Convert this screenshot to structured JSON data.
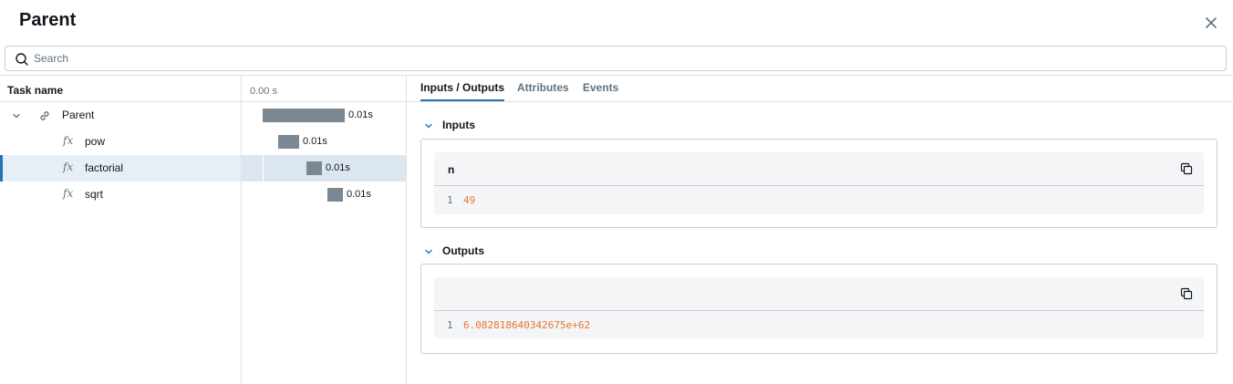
{
  "header": {
    "title": "Parent",
    "close_icon": "close-icon"
  },
  "search": {
    "placeholder": "Search",
    "value": ""
  },
  "tree": {
    "column_header": "Task name",
    "rows": [
      {
        "label": "Parent",
        "icon": "link-icon",
        "expanded": true
      },
      {
        "label": "pow",
        "icon": "function-icon"
      },
      {
        "label": "factorial",
        "icon": "function-icon",
        "selected": true
      },
      {
        "label": "sqrt",
        "icon": "function-icon"
      }
    ]
  },
  "timeline": {
    "header": "0.00 s",
    "rows": [
      {
        "duration": "0.01s"
      },
      {
        "duration": "0.01s"
      },
      {
        "duration": "0.01s"
      },
      {
        "duration": "0.01s"
      }
    ]
  },
  "detail": {
    "tabs": [
      {
        "label": "Inputs / Outputs",
        "active": true
      },
      {
        "label": "Attributes"
      },
      {
        "label": "Events"
      }
    ],
    "inputs": {
      "title": "Inputs",
      "key": "n",
      "line_number": "1",
      "value": "49"
    },
    "outputs": {
      "title": "Outputs",
      "key": "",
      "line_number": "1",
      "value": "6.082818640342675e+62"
    }
  },
  "colors": {
    "accent": "#2272b4",
    "bar": "#7b8793",
    "value_orange": "#e6772e",
    "selected_row": "#e8eef6"
  }
}
